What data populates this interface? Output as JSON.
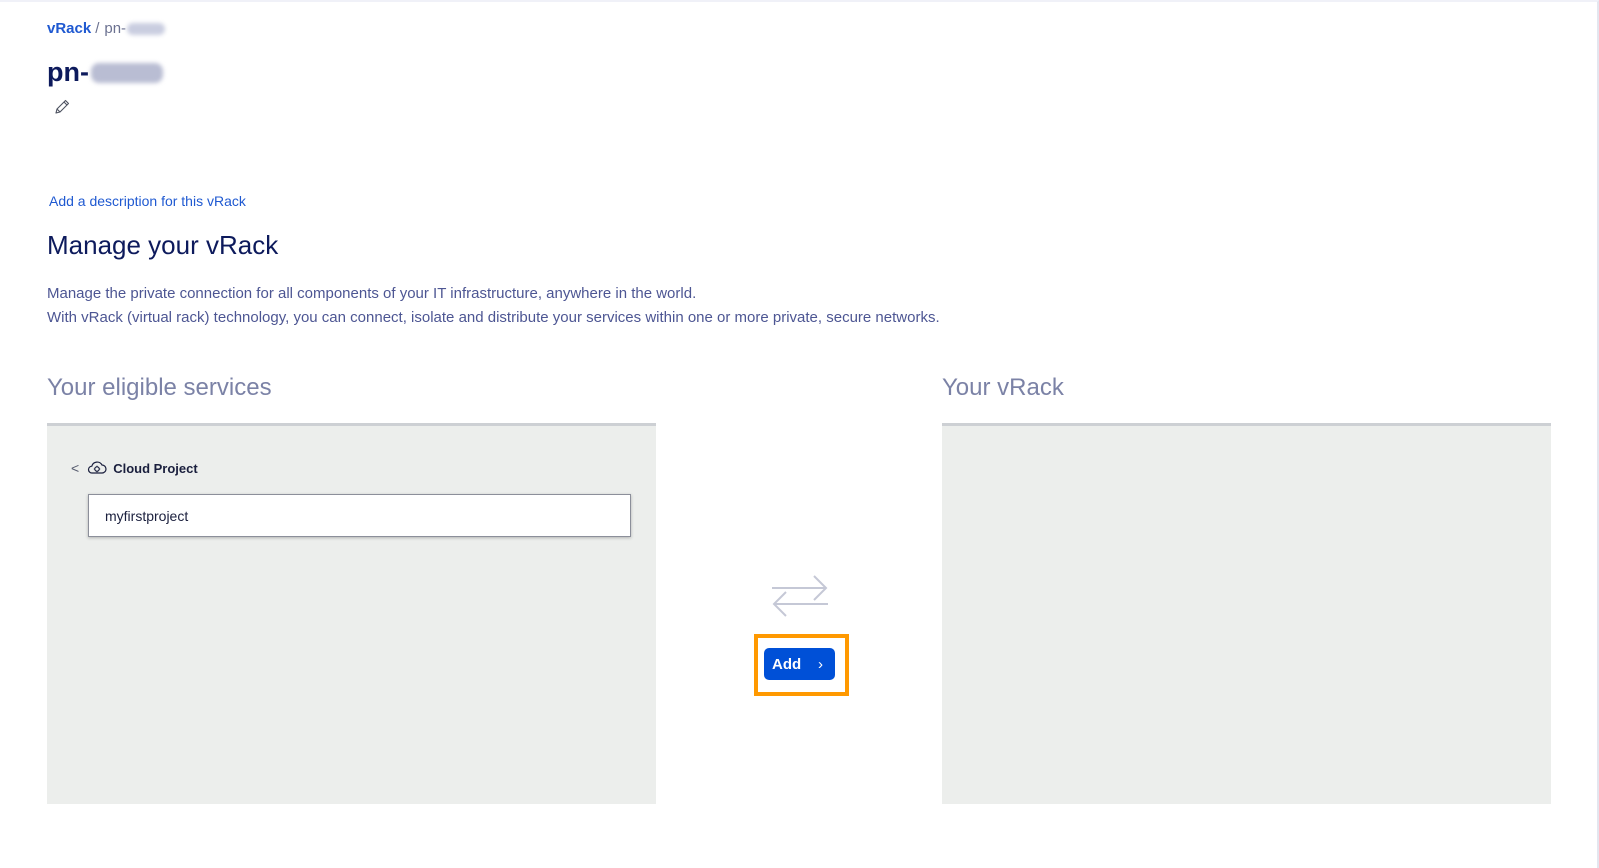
{
  "breadcrumb": {
    "root": "vRack",
    "separator": "/",
    "current_prefix": "pn-"
  },
  "page": {
    "title_prefix": "pn-",
    "add_description_link": "Add a description for this vRack"
  },
  "manage": {
    "title": "Manage your vRack",
    "intro_line1": "Manage the private connection for all components of your IT infrastructure, anywhere in the world.",
    "intro_line2": "With vRack (virtual rack) technology, you can connect, isolate and distribute your services within one or more private, secure networks."
  },
  "eligible": {
    "title": "Your eligible services",
    "group_back": "<",
    "group_icon": "cloud-project-icon",
    "group_label": "Cloud Project",
    "items": [
      {
        "label": "myfirstproject"
      }
    ]
  },
  "vrack": {
    "title": "Your vRack"
  },
  "actions": {
    "swap_icon": "swap-arrows-icon",
    "add_label": "Add",
    "add_chevron": "›"
  },
  "colors": {
    "brand_blue": "#0050d7",
    "link_blue": "#1f59d1",
    "title_navy": "#0d1a5c",
    "highlight_orange": "#ff9900",
    "panel_gray": "#eceeec"
  }
}
